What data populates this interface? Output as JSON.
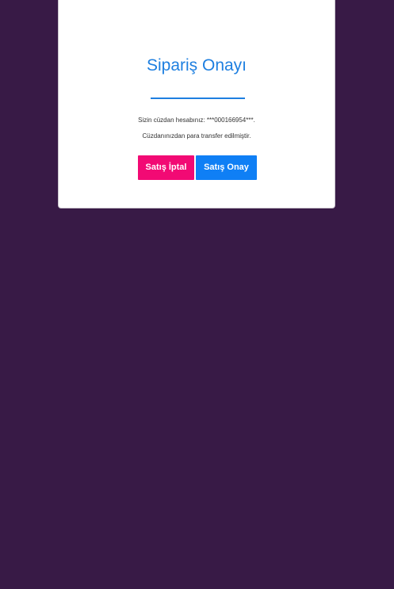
{
  "dialog": {
    "title": "Sipariş Onayı",
    "wallet_line": "Sizin cüzdan hesabınız: ***000166954***.",
    "transfer_line": "Cüzdanınızdan para transfer edilmiştir.",
    "cancel_label": "Satış İptal",
    "confirm_label": "Satış Onay"
  },
  "colors": {
    "background": "#381a46",
    "accent": "#1e7fe0",
    "cancel": "#f20a74",
    "confirm": "#0f7ff5"
  }
}
